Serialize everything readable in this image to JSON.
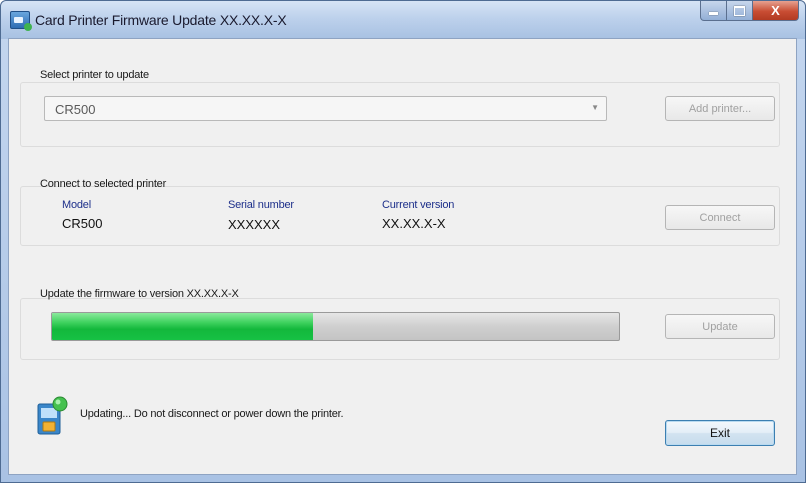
{
  "window": {
    "title": "Card Printer Firmware Update XX.XX.X-X",
    "controls": {
      "minimize": "minimize",
      "maximize": "maximize",
      "close": "X"
    }
  },
  "select_group": {
    "label": "Select printer to update",
    "printer_dropdown": {
      "value": "CR500",
      "arrow_icon": "chevron-down-icon"
    },
    "add_printer_button": "Add printer..."
  },
  "connect_group": {
    "label": "Connect to selected printer",
    "columns": [
      {
        "header": "Model",
        "value": "CR500"
      },
      {
        "header": "Serial number",
        "value": "XXXXXX"
      },
      {
        "header": "Current version",
        "value": "XX.XX.X-X"
      }
    ],
    "connect_button": "Connect"
  },
  "update_group": {
    "label": "Update the firmware to version XX.XX.X-X",
    "progress_fraction": 0.46,
    "update_button": "Update"
  },
  "status": {
    "icon": "firmware-update-icon",
    "message": "Updating... Do not disconnect or power down the printer."
  },
  "exit_button": "Exit",
  "colors": {
    "progress_fill": "#16c144",
    "column_header": "#1d2f8a",
    "close_button": "#c84d33"
  }
}
